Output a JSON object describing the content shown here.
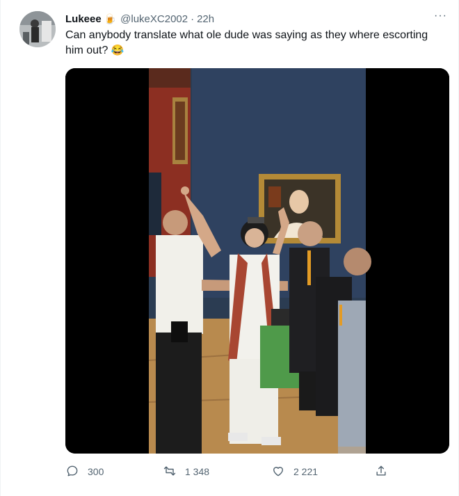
{
  "tweet": {
    "display_name": "Lukeee",
    "name_emoji": "🍺",
    "handle": "@lukeXC2002",
    "separator": "·",
    "time": "22h",
    "text": "Can anybody translate what ole dude was saying as they where escorting him out?",
    "text_emoji": "😂",
    "more_label": "···"
  },
  "actions": {
    "reply_count": "300",
    "retweet_count": "1 348",
    "like_count": "2 221"
  },
  "icons": {
    "reply": "reply-icon",
    "retweet": "retweet-icon",
    "like": "heart-icon",
    "share": "share-icon"
  },
  "colors": {
    "text": "#0f1419",
    "secondary": "#536471",
    "media_background": "#000000"
  }
}
